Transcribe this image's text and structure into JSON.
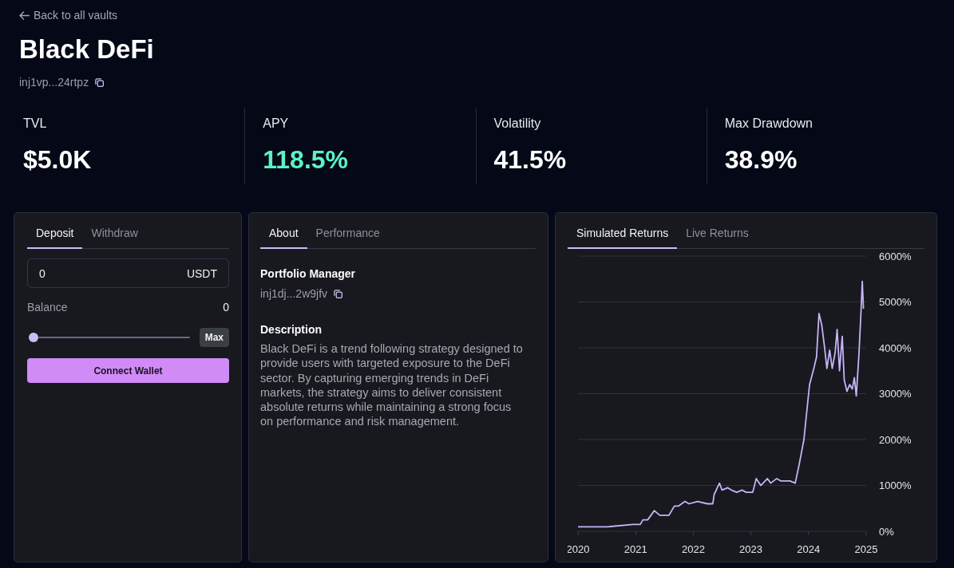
{
  "back_link": {
    "label": "Back to all vaults"
  },
  "vault": {
    "title": "Black DeFi",
    "address": "inj1vp...24rtpz"
  },
  "stats": [
    {
      "label": "TVL",
      "value": "$5.0K",
      "kind": "plain"
    },
    {
      "label": "APY",
      "value": "118.5%",
      "kind": "highlight"
    },
    {
      "label": "Volatility",
      "value": "41.5%",
      "kind": "plain"
    },
    {
      "label": "Max Drawdown",
      "value": "38.9%",
      "kind": "plain"
    }
  ],
  "deposit_panel": {
    "tabs": [
      {
        "label": "Deposit",
        "selected": true
      },
      {
        "label": "Withdraw",
        "selected": false
      }
    ],
    "amount": {
      "value": "0",
      "unit": "USDT"
    },
    "balance": {
      "label": "Balance",
      "value": "0"
    },
    "slider": {
      "level": 0
    },
    "max_button": "Max",
    "connect_button": "Connect Wallet"
  },
  "about_panel": {
    "tabs": [
      {
        "label": "About",
        "selected": true
      },
      {
        "label": "Performance",
        "selected": false
      }
    ],
    "sections": [
      {
        "heading": "Portfolio Manager",
        "kind": "address",
        "text": "inj1dj...2w9jfv"
      },
      {
        "heading": "Description",
        "kind": "paragraph",
        "text": "Black DeFi is a trend following strategy designed to provide users with targeted exposure to the DeFi sector. By capturing emerging trends in DeFi markets, the strategy aims to deliver consistent absolute returns while maintaining a strong focus on performance and risk management."
      }
    ]
  },
  "returns_panel": {
    "tabs": [
      {
        "label": "Simulated Returns",
        "selected": true
      },
      {
        "label": "Live Returns",
        "selected": false
      }
    ],
    "chart_data": [
      {
        "type": "line",
        "grid": true,
        "color": "#c5b4f7",
        "xlim": [
          "2020-01-01",
          "2025-01-01"
        ],
        "ylim": [
          0,
          6000
        ],
        "xticks": [
          {
            "value": "2020-01-01",
            "label": "2020"
          },
          {
            "value": "2021-01-01",
            "label": "2021"
          },
          {
            "value": "2022-01-01",
            "label": "2022"
          },
          {
            "value": "2023-01-01",
            "label": "2023"
          },
          {
            "value": "2024-01-01",
            "label": "2024"
          },
          {
            "value": "2025-01-01",
            "label": "2025"
          }
        ],
        "yticks": [
          {
            "value": 0,
            "label": "0%"
          },
          {
            "value": 1000,
            "label": "1000%"
          },
          {
            "value": 2000,
            "label": "2000%"
          },
          {
            "value": 3000,
            "label": "3000%"
          },
          {
            "value": 4000,
            "label": "4000%"
          },
          {
            "value": 5000,
            "label": "5000%"
          },
          {
            "value": 6000,
            "label": "6000%"
          }
        ],
        "x": [
          "2020-01-01",
          "2020-07-08",
          "2020-12-15",
          "2021-01-30",
          "2021-02-16",
          "2021-03-18",
          "2021-04-29",
          "2021-06-02",
          "2021-06-30",
          "2021-07-31",
          "2021-09-03",
          "2021-09-28",
          "2021-11-09",
          "2021-12-04",
          "2022-01-29",
          "2022-04-01",
          "2022-05-05",
          "2022-05-13",
          "2022-06-16",
          "2022-07-02",
          "2022-08-06",
          "2022-08-31",
          "2022-10-03",
          "2022-11-06",
          "2022-12-02",
          "2023-01-13",
          "2023-02-04",
          "2023-03-05",
          "2023-04-16",
          "2023-05-06",
          "2023-06-14",
          "2023-07-09",
          "2023-08-08",
          "2023-09-06",
          "2023-10-09",
          "2023-11-03",
          "2023-12-03",
          "2023-12-24",
          "2024-01-08",
          "2024-02-04",
          "2024-02-21",
          "2024-03-08",
          "2024-03-25",
          "2024-04-11",
          "2024-04-27",
          "2024-05-14",
          "2024-05-31",
          "2024-06-18",
          "2024-07-01",
          "2024-07-16",
          "2024-08-02",
          "2024-08-15",
          "2024-09-01",
          "2024-09-18",
          "2024-10-05",
          "2024-10-18",
          "2024-10-30",
          "2024-11-16",
          "2024-11-28",
          "2024-12-07",
          "2024-12-15"
        ],
        "values": [
          100,
          100,
          150,
          150,
          250,
          250,
          450,
          350,
          350,
          350,
          550,
          550,
          650,
          600,
          650,
          600,
          600,
          800,
          1050,
          900,
          950,
          900,
          850,
          900,
          850,
          850,
          1150,
          1000,
          1150,
          1050,
          1150,
          1100,
          1100,
          1100,
          1050,
          1450,
          2000,
          2700,
          3200,
          3550,
          3800,
          4750,
          4500,
          4050,
          3550,
          3950,
          3550,
          3900,
          4400,
          3500,
          4250,
          3300,
          3050,
          3200,
          3100,
          3350,
          2950,
          3850,
          4700,
          5450,
          4850
        ]
      }
    ]
  }
}
